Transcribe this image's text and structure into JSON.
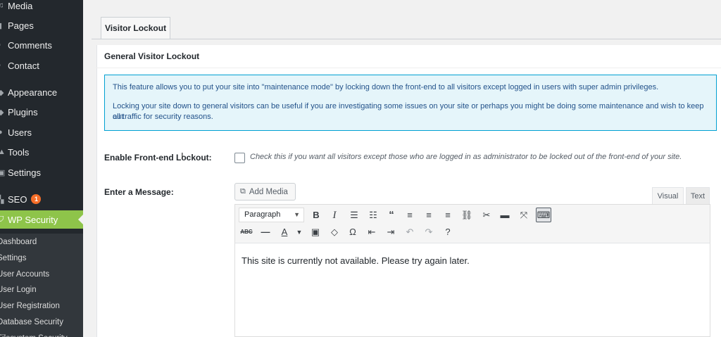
{
  "sidebar": {
    "items": [
      {
        "label": "Media",
        "icon": "media-icon"
      },
      {
        "label": "Pages",
        "icon": "pages-icon"
      },
      {
        "label": "Comments",
        "icon": "comments-icon"
      },
      {
        "label": "Contact",
        "icon": "contact-icon"
      },
      {
        "label": "Appearance",
        "icon": "appearance-icon"
      },
      {
        "label": "Plugins",
        "icon": "plugins-icon"
      },
      {
        "label": "Users",
        "icon": "users-icon"
      },
      {
        "label": "Tools",
        "icon": "tools-icon"
      },
      {
        "label": "Settings",
        "icon": "settings-icon"
      },
      {
        "label": "SEO",
        "icon": "seo-icon",
        "badge": "1"
      },
      {
        "label": "WP Security",
        "icon": "shield-icon",
        "active": true
      }
    ],
    "submenu": [
      {
        "label": "Dashboard"
      },
      {
        "label": "Settings"
      },
      {
        "label": "User Accounts"
      },
      {
        "label": "User Login"
      },
      {
        "label": "User Registration"
      },
      {
        "label": "Database Security"
      },
      {
        "label": "Filesystem Security"
      }
    ]
  },
  "tabs": {
    "active_label": "Visitor Lockout"
  },
  "panel": {
    "title": "General Visitor Lockout",
    "info": {
      "p1": "This feature allows you to put your site into \"maintenance mode\" by locking down the front-end to all visitors except logged in users with super admin privileges.",
      "p2a": "Locking your site down to general visitors can be useful if you are investigating some issues on your site or perhaps you might be doing some maintenance and wish to keep out",
      "p2b": "all traffic for security reasons."
    },
    "lockout": {
      "label": "Enable Front-end Lockout:",
      "checked": false,
      "description": "Check this if you want all visitors except those who are logged in as administrator to be locked out of the front-end of your site."
    },
    "message": {
      "label": "Enter a Message:",
      "add_media": "Add Media",
      "tab_visual": "Visual",
      "tab_text": "Text",
      "format": "Paragraph",
      "content": "This site is currently not available. Please try again later."
    }
  },
  "colors": {
    "sidebar_bg": "#23282d",
    "active_bg": "#8ec44a",
    "info_border": "#00a0d2",
    "badge": "#f56e28"
  }
}
